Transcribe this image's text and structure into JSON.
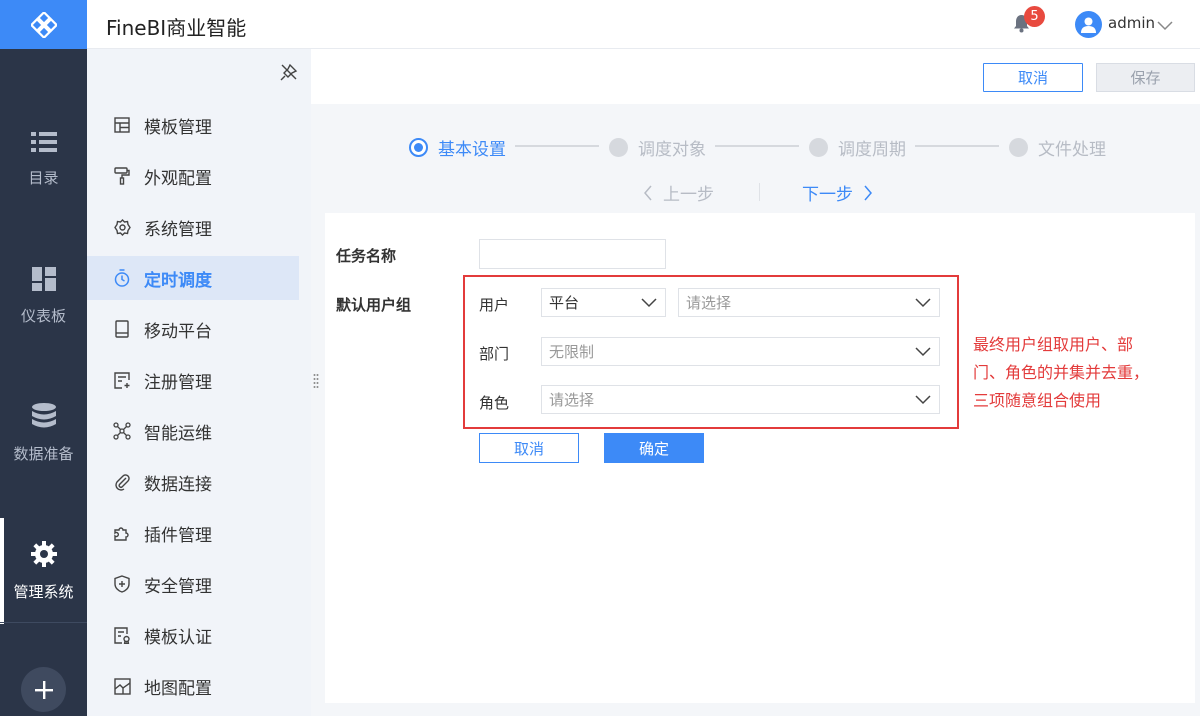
{
  "rail": {
    "items": [
      {
        "label": "目录",
        "icon": "list-icon"
      },
      {
        "label": "仪表板",
        "icon": "dashboard-icon"
      },
      {
        "label": "数据准备",
        "icon": "database-icon"
      },
      {
        "label": "管理系统",
        "icon": "gear-icon",
        "active": true
      }
    ]
  },
  "header": {
    "app_title": "FineBI商业智能",
    "notification_count": "5",
    "username": "admin"
  },
  "submenu": {
    "items": [
      {
        "label": "模板管理",
        "icon": "template-icon"
      },
      {
        "label": "外观配置",
        "icon": "paint-roller-icon"
      },
      {
        "label": "系统管理",
        "icon": "settings-icon"
      },
      {
        "label": "定时调度",
        "icon": "timer-icon",
        "active": true
      },
      {
        "label": "移动平台",
        "icon": "tablet-icon"
      },
      {
        "label": "注册管理",
        "icon": "register-icon"
      },
      {
        "label": "智能运维",
        "icon": "network-icon"
      },
      {
        "label": "数据连接",
        "icon": "paperclip-icon"
      },
      {
        "label": "插件管理",
        "icon": "puzzle-icon"
      },
      {
        "label": "安全管理",
        "icon": "shield-icon"
      },
      {
        "label": "模板认证",
        "icon": "certificate-icon"
      },
      {
        "label": "地图配置",
        "icon": "map-icon"
      }
    ]
  },
  "toolbar": {
    "cancel_label": "取消",
    "save_label": "保存"
  },
  "steps": {
    "items": [
      {
        "label": "基本设置",
        "active": true
      },
      {
        "label": "调度对象"
      },
      {
        "label": "调度周期"
      },
      {
        "label": "文件处理"
      }
    ],
    "prev_label": "上一步",
    "next_label": "下一步"
  },
  "form": {
    "task_name_label": "任务名称",
    "task_name_value": "",
    "default_group_label": "默认用户组",
    "user_label": "用户",
    "user_type_value": "平台",
    "user_select_placeholder": "请选择",
    "dept_label": "部门",
    "dept_value": "无限制",
    "role_label": "角色",
    "role_placeholder": "请选择",
    "cancel_label": "取消",
    "ok_label": "确定"
  },
  "annotation": {
    "text": "最终用户组取用户、部门、角色的并集并去重，三项随意组合使用"
  },
  "colors": {
    "accent": "#3d8af7",
    "rail_bg": "#2b3548",
    "annotation_red": "#e33b3b"
  }
}
